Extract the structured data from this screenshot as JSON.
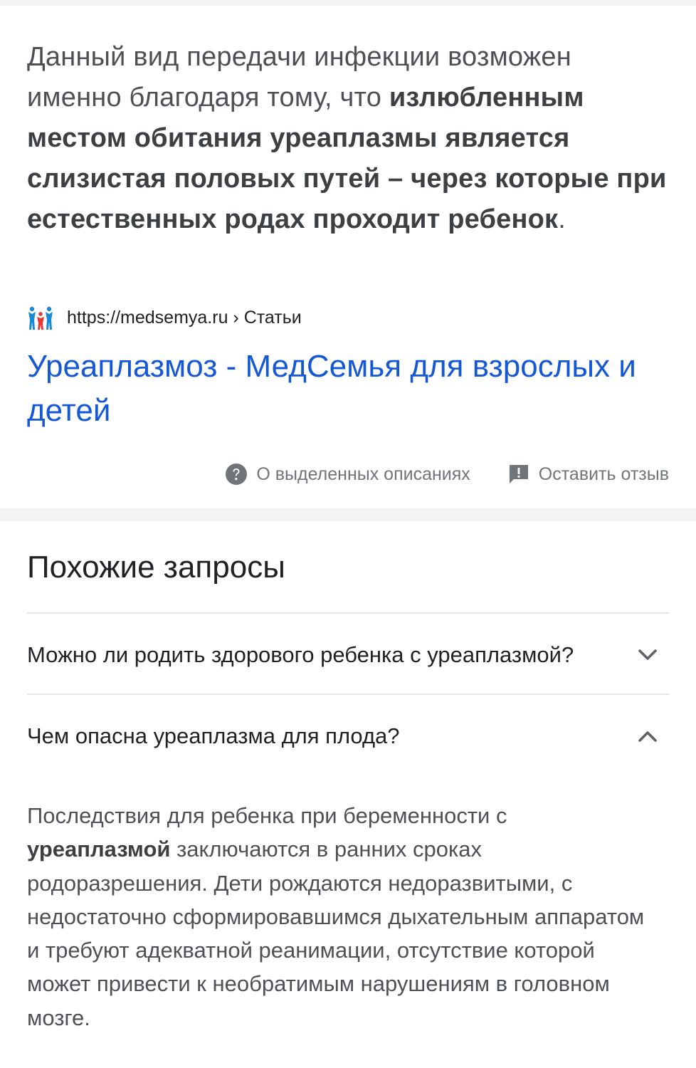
{
  "featured_snippet": {
    "text_before": "Данный вид передачи инфекции возможен именно благодаря тому, что ",
    "text_bold": "излюбленным местом обитания уреаплазмы является слизистая половых путей – через которые при естественных родах проходит ребенок",
    "text_after": ".",
    "source_url": "https://medsemya.ru › Статьи",
    "result_title": "Уреаплазмоз - МедСемья для взрослых и детей",
    "about_label": "О выделенных описаниях",
    "feedback_label": "Оставить отзыв"
  },
  "related": {
    "title": "Похожие запросы",
    "questions": [
      {
        "text": "Можно ли родить здорового ребенка с уреаплазмой?",
        "expanded": false,
        "icon": "chevron-down-icon"
      },
      {
        "text": "Чем опасна уреаплазма для плода?",
        "expanded": true,
        "icon": "chevron-up-icon"
      }
    ],
    "answer": {
      "text_before": "Последствия для ребенка при беременности с ",
      "text_bold": "уреаплазмой",
      "text_after": " заключаются в ранних сроках родоразрешения. Дети рождаются недоразвитыми, с недостаточно сформировавшимся дыхательным аппаратом и требуют адекватной реанимации, отсутствие которой может привести к необратимым нарушениям в головном мозге."
    }
  },
  "colors": {
    "link": "#1558d6",
    "text": "#4d5156",
    "muted": "#70757a",
    "separator": "#f1f3f4",
    "favicon_blue": "#1a8ad4",
    "favicon_red": "#e53935"
  }
}
